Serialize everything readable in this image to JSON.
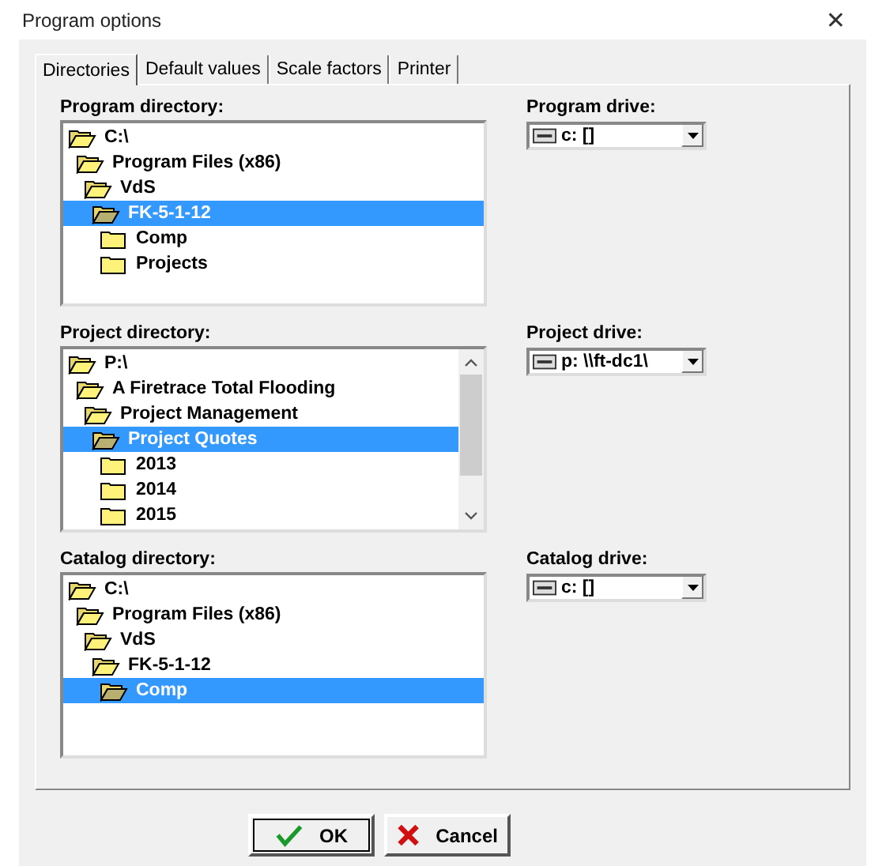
{
  "window": {
    "title": "Program options",
    "close": "✕"
  },
  "tabs": [
    {
      "label": "Directories",
      "selected": true
    },
    {
      "label": "Default values",
      "selected": false
    },
    {
      "label": "Scale factors",
      "selected": false
    },
    {
      "label": "Printer",
      "selected": false
    }
  ],
  "sections": [
    {
      "label": "Program directory:",
      "scrollbar": false,
      "tree": [
        {
          "name": "C:\\",
          "kind": "open",
          "selected": false,
          "children": [
            {
              "name": "Program Files (x86)",
              "kind": "open",
              "selected": false,
              "children": [
                {
                  "name": "VdS",
                  "kind": "open",
                  "selected": false,
                  "children": [
                    {
                      "name": "FK-5-1-12",
                      "kind": "open",
                      "selected": true,
                      "children": [
                        {
                          "name": "Comp",
                          "kind": "closed",
                          "selected": false
                        },
                        {
                          "name": "Projects",
                          "kind": "closed",
                          "selected": false
                        }
                      ]
                    }
                  ]
                }
              ]
            }
          ]
        }
      ],
      "drive_label": "Program drive:",
      "drive_value": "c: []"
    },
    {
      "label": "Project directory:",
      "scrollbar": true,
      "tree": [
        {
          "name": "P:\\",
          "kind": "open",
          "selected": false,
          "children": [
            {
              "name": "A Firetrace Total Flooding",
              "kind": "open",
              "selected": false,
              "children": [
                {
                  "name": "Project Management",
                  "kind": "open",
                  "selected": false,
                  "children": [
                    {
                      "name": "Project Quotes",
                      "kind": "open",
                      "selected": true,
                      "children": [
                        {
                          "name": "2013",
                          "kind": "closed",
                          "selected": false
                        },
                        {
                          "name": "2014",
                          "kind": "closed",
                          "selected": false
                        },
                        {
                          "name": "2015",
                          "kind": "closed",
                          "selected": false
                        }
                      ]
                    }
                  ]
                }
              ]
            }
          ]
        }
      ],
      "drive_label": "Project drive:",
      "drive_value": "p: \\\\ft-dc1\\"
    },
    {
      "label": "Catalog directory:",
      "scrollbar": false,
      "tree": [
        {
          "name": "C:\\",
          "kind": "open",
          "selected": false,
          "children": [
            {
              "name": "Program Files (x86)",
              "kind": "open",
              "selected": false,
              "children": [
                {
                  "name": "VdS",
                  "kind": "open",
                  "selected": false,
                  "children": [
                    {
                      "name": "FK-5-1-12",
                      "kind": "open",
                      "selected": false,
                      "children": [
                        {
                          "name": "Comp",
                          "kind": "open",
                          "selected": true
                        }
                      ]
                    }
                  ]
                }
              ]
            }
          ]
        }
      ],
      "drive_label": "Catalog drive:",
      "drive_value": "c: []"
    }
  ],
  "buttons": [
    {
      "label": "OK",
      "kind": "ok"
    },
    {
      "label": "Cancel",
      "kind": "cancel"
    }
  ]
}
